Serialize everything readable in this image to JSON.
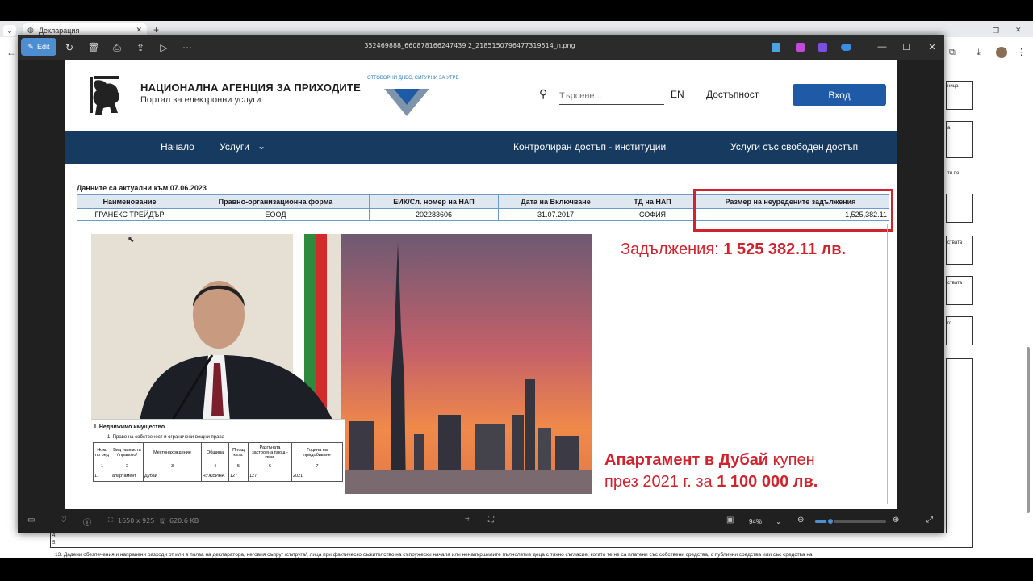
{
  "browser": {
    "tab_title": "Декларация",
    "bottom_note": "13. Дадени обезпечения и направени разходи от или в полза на декларатора, неговия съпруг /съпруга/, лица при фактическо съжителство на съпружески начала или ненавършилите пълнолетие деца с тяхно съгласие, когато те не са платени със собствени средства, с публични средства или със средства на",
    "bg_labels": [
      "ница",
      "а",
      "ти по",
      "ствата",
      "ствата",
      "го"
    ],
    "bg_rows": [
      "4.",
      "5."
    ]
  },
  "viewer": {
    "edit_label": "Edit",
    "file_name": "352469888_660878166247439 2_2185150796477319514_n.png",
    "dimensions": "1650 x 925",
    "file_size": "620.6 KB",
    "zoom": "94%",
    "zoom_level": 0.94
  },
  "nap": {
    "name": "НАЦИОНАЛНА АГЕНЦИЯ ЗА ПРИХОДИТЕ",
    "portal": "Портал за електронни услуги",
    "slogan": "ОТГОВОРНИ ДНЕС, СИГУРНИ ЗА УТРЕ",
    "search_placeholder": "Търсене...",
    "lang": "EN",
    "accessibility": "Достъпност",
    "login": "Вход",
    "nav": {
      "home": "Начало",
      "services": "Услуги",
      "controlled": "Контролиран достъп - институции",
      "free": "Услуги със свободен достъп"
    },
    "data_date": "Данните са актуални към 07.06.2023",
    "table": {
      "headers": [
        "Наименование",
        "Правно-организационна форма",
        "ЕИК/Сл. номер на НАП",
        "Дата на Включване",
        "ТД на НАП",
        "Размер на неуредените задължения"
      ],
      "row": [
        "ГРАНЕКС ТРЕЙДЪР",
        "ЕООД",
        "202283606",
        "31.07.2017",
        "СОФИЯ",
        "1,525,382.11"
      ]
    }
  },
  "overlay": {
    "debt_label": "Задължения: ",
    "debt_amount": "1 525 382.11 лв.",
    "dubai_bold": "Апартамент в Дубай",
    "dubai_rest1": " купен",
    "dubai_rest2": "през 2021 г. за ",
    "dubai_amount": "1 100 000 лв."
  },
  "property": {
    "title": "I. Недвижимо имущество",
    "subtitle": "1. Право на собственост и ограничени вещни права",
    "headers": [
      "Ном. по ред",
      "Вид на имота / правото/",
      "Местонахождение",
      "Община",
      "Площ кв.м.",
      "Разгъната застроена площ - кв.м.",
      "Година на придобиване"
    ],
    "nums": [
      "1",
      "2",
      "3",
      "4",
      "5",
      "6",
      "7"
    ],
    "row": [
      "1.",
      "апартамент",
      "Дубай",
      "ЧУЖБИНА",
      "127",
      "127",
      "2021"
    ]
  },
  "colors": {
    "nap_navy": "#163a60",
    "login_blue": "#1f5aa6",
    "highlight_red": "#d0232d",
    "edit_blue": "#4c8ed1"
  },
  "icons": [
    "edit-pen-icon",
    "rotate-icon",
    "delete-icon",
    "print-icon",
    "share-icon",
    "slideshow-icon",
    "more-icon",
    "heart-icon",
    "info-icon",
    "fit-icon",
    "zoom-out-icon",
    "zoom-in-icon",
    "expand-icon",
    "search-icon",
    "chevron-down-icon",
    "lion-logo-icon",
    "nap-emblem-icon"
  ]
}
